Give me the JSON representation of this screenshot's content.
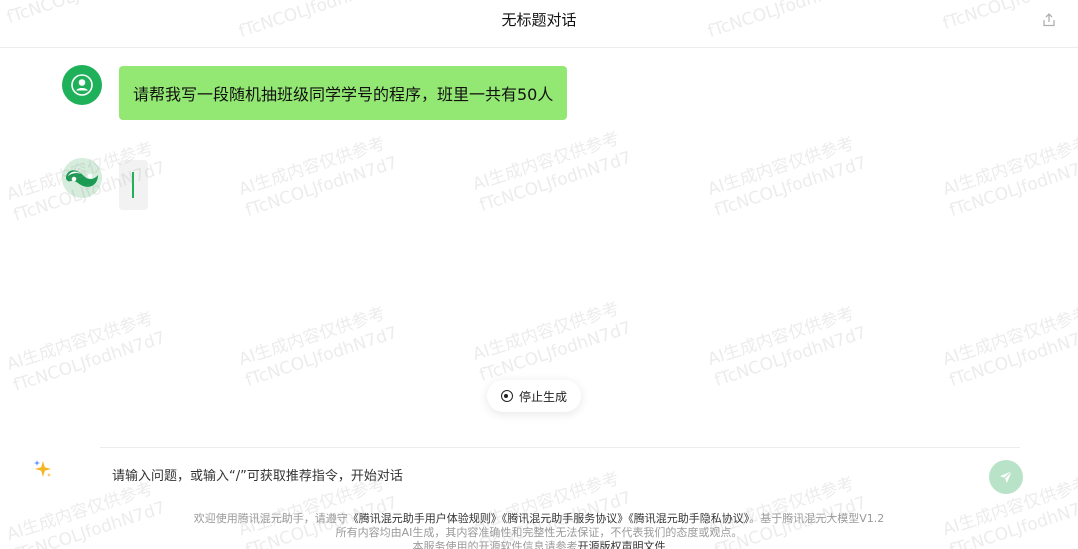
{
  "header": {
    "title": "无标题对话",
    "share_icon": "share-icon"
  },
  "conversation": {
    "user_message": "请帮我写一段随机抽班级同学学号的程序，班里一共有50人",
    "user_avatar_icon": "user-avatar-icon",
    "bot_avatar_icon": "hunyuan-logo-icon",
    "bot_state": "generating"
  },
  "controls": {
    "stop_label": "停止生成"
  },
  "input": {
    "placeholder": "请输入问题，或输入“/”可获取推荐指令，开始对话",
    "value": ""
  },
  "footer": {
    "line1_prefix": "欢迎使用腾讯混元助手，请遵守",
    "link_rules": "《腾讯混元助手用户体验规则》",
    "link_service": "《腾讯混元助手服务协议》",
    "link_privacy": "《腾讯混元助手隐私协议》",
    "line1_suffix": "。基于腾讯混元大模型V1.2",
    "line2": "所有内容均由AI生成，其内容准确性和完整性无法保证，不代表我们的态度或观点。",
    "line3_prefix": "本服务使用的开源软件信息请参考",
    "link_license": "开源版权声明文件"
  },
  "watermark": {
    "line1": "AI生成内容仅供参考",
    "line2": "fTcNCOLJfodhN7d7"
  },
  "colors": {
    "accent_green": "#1fb05a",
    "user_bubble": "#93e873",
    "send_disabled": "#b9e3c8"
  }
}
